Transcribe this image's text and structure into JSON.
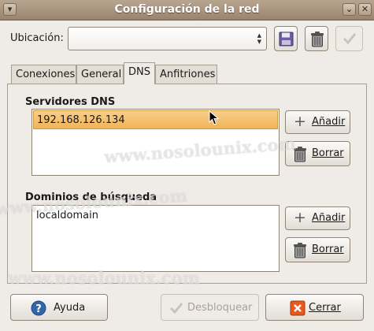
{
  "window": {
    "title": "Configuración de la red",
    "minimize_glyph": "⌄",
    "close_glyph": "✕"
  },
  "location": {
    "label": "Ubicación:",
    "value": ""
  },
  "toolbar": {
    "save_icon": "floppy-disk-icon",
    "delete_icon": "trash-icon",
    "apply_icon": "checkmark-icon"
  },
  "tabs": [
    {
      "label": "Conexiones",
      "active": false
    },
    {
      "label": "General",
      "active": false
    },
    {
      "label": "DNS",
      "active": true
    },
    {
      "label": "Anfitriones",
      "active": false
    }
  ],
  "dns": {
    "servers_title": "Servidores DNS",
    "servers": [
      "192.168.126.134"
    ],
    "domains_title": "Dominios de búsqueda",
    "domains": [
      "localdomain"
    ],
    "add_label": "Añadir",
    "remove_label": "Borrar"
  },
  "footer": {
    "help_label": "Ayuda",
    "unlock_label": "Desbloquear",
    "close_label": "Cerrar"
  },
  "watermark": [
    "www.nosolounix.com",
    "www.nosolounix.com",
    "www.nosolounix.com"
  ],
  "colors": {
    "selection": "#f1b458",
    "titlebar": "#9a8470",
    "close_red": "#e8571e"
  }
}
